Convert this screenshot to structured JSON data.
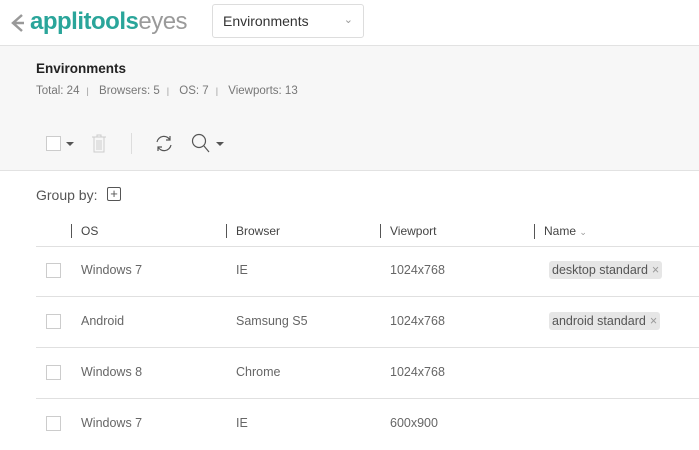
{
  "header": {
    "logo_primary": "applitools",
    "logo_secondary": "eyes",
    "selector_value": "Environments"
  },
  "panel": {
    "title": "Environments",
    "stats": [
      "Total: 24",
      "Browsers: 5",
      "OS: 7",
      "Viewports: 13"
    ]
  },
  "groupby": {
    "label": "Group by:"
  },
  "table": {
    "columns": [
      "OS",
      "Browser",
      "Viewport",
      "Name"
    ],
    "rows": [
      {
        "os": "Windows 7",
        "browser": "IE",
        "viewport": "1024x768",
        "name": "desktop standard"
      },
      {
        "os": "Android",
        "browser": "Samsung S5",
        "viewport": "1024x768",
        "name": "android standard"
      },
      {
        "os": "Windows 8",
        "browser": "Chrome",
        "viewport": "1024x768",
        "name": ""
      },
      {
        "os": "Windows 7",
        "browser": "IE",
        "viewport": "600x900",
        "name": ""
      }
    ]
  }
}
